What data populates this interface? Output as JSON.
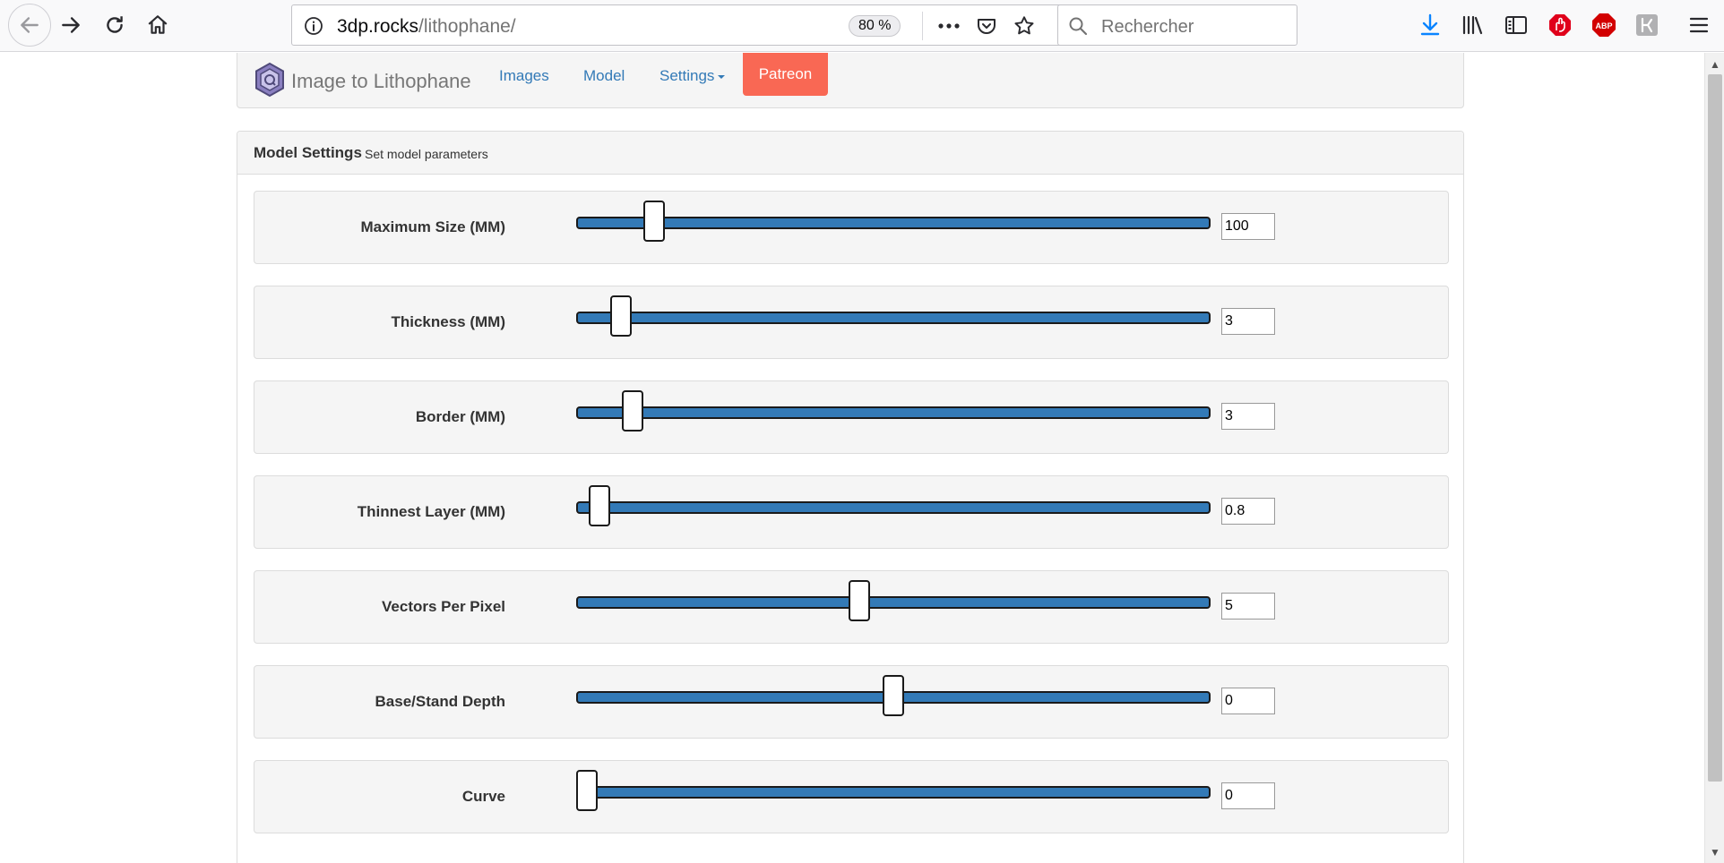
{
  "browser": {
    "url_host": "3dp.rocks",
    "url_path": "/lithophane/",
    "zoom": "80 %",
    "search_placeholder": "Rechercher",
    "accent_download": "#0a84ff",
    "accent_opera": "#e0001b",
    "accent_abp": "#d20000"
  },
  "nav": {
    "brand": "Image to Lithophane",
    "links": [
      "Images",
      "Model",
      "Settings"
    ],
    "patreon": "Patreon",
    "patreon_color": "#f96854"
  },
  "panel": {
    "title": "Model Settings",
    "subtitle": "Set model parameters"
  },
  "settings": [
    {
      "label": "Maximum Size (MM)",
      "value": "100",
      "slider_fraction": 0.11
    },
    {
      "label": "Thickness (MM)",
      "value": "3",
      "slider_fraction": 0.055
    },
    {
      "label": "Border (MM)",
      "value": "3",
      "slider_fraction": 0.075
    },
    {
      "label": "Thinnest Layer (MM)",
      "value": "0.8",
      "slider_fraction": 0.02
    },
    {
      "label": "Vectors Per Pixel",
      "value": "5",
      "slider_fraction": 0.445
    },
    {
      "label": "Base/Stand Depth",
      "value": "0",
      "slider_fraction": 0.5
    },
    {
      "label": "Curve",
      "value": "0",
      "slider_fraction": 0.0
    }
  ]
}
